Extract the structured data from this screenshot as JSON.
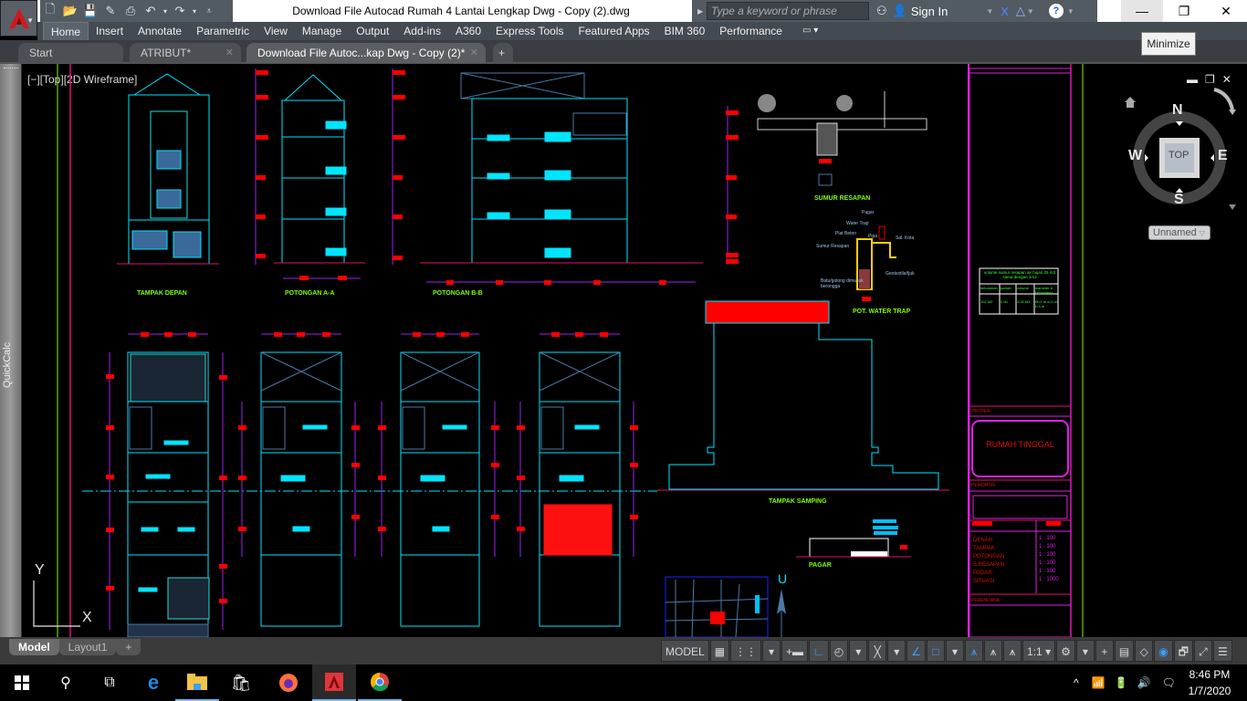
{
  "app": {
    "name": "AutoCAD",
    "document_title": "Download File Autocad Rumah 4 Lantai Lengkap Dwg - Copy (2).dwg"
  },
  "quick_access": [
    "new-icon",
    "open-icon",
    "save-icon",
    "save-as-icon",
    "plot-icon",
    "undo-icon",
    "redo-icon",
    "customize-icon"
  ],
  "infocenter": {
    "search_placeholder": "Type a keyword or phrase",
    "sign_in": "Sign In",
    "help": "?"
  },
  "window_controls": {
    "minimize": "—",
    "restore": "❐",
    "close": "✕",
    "tooltip": "Minimize"
  },
  "ribbon_tabs": [
    {
      "label": "Home",
      "active": true
    },
    {
      "label": "Insert"
    },
    {
      "label": "Annotate"
    },
    {
      "label": "Parametric"
    },
    {
      "label": "View"
    },
    {
      "label": "Manage"
    },
    {
      "label": "Output"
    },
    {
      "label": "Add-ins"
    },
    {
      "label": "A360"
    },
    {
      "label": "Express Tools"
    },
    {
      "label": "Featured Apps"
    },
    {
      "label": "BIM 360"
    },
    {
      "label": "Performance"
    }
  ],
  "doc_tabs": [
    {
      "label": "Start"
    },
    {
      "label": "ATRIBUT*"
    },
    {
      "label": "Download File Autoc...kap Dwg - Copy (2)*",
      "active": true
    }
  ],
  "side_palette": {
    "label": "QuickCalc"
  },
  "viewport": {
    "label": "[−][Top][2D Wireframe]",
    "ucs": {
      "x": "X",
      "y": "Y"
    },
    "viewcube": {
      "n": "N",
      "s": "S",
      "e": "E",
      "w": "W",
      "face": "TOP",
      "named_view": "Unnamed"
    }
  },
  "drawing": {
    "view_titles": [
      "TAMPAK DEPAN",
      "POTONGAN A-A",
      "POTONGAN B-B",
      "SUMUR RESAPAN",
      "POT. WATER TRAP",
      "TAMPAK SAMPING",
      "PAGAR"
    ],
    "north_label": "U",
    "water_trap_labels": [
      "Pagar",
      "Water Trap",
      "Plat Beton",
      "Pipa",
      "Sal. Kota",
      "Sumur Resapan",
      "Geotextile/Ijuk",
      "Batu/golong dimasuk berongga"
    ],
    "title_block": {
      "proyek_label": "PROYEK",
      "project_name": "RUMAH TINGGAL",
      "pemohon_label": "PEMOHON",
      "drawings": [
        {
          "name": "DENAH",
          "scale": "1 : 100"
        },
        {
          "name": "TAMPAK",
          "scale": "1 : 100"
        },
        {
          "name": "POTONGAN",
          "scale": "1 : 100"
        },
        {
          "name": "S.RESAPAN",
          "scale": "1 : 100"
        },
        {
          "name": "PAGAR",
          "scale": "1 : 100"
        },
        {
          "name": "SITUASI",
          "scale": "1 : 1000"
        }
      ],
      "perencana_label": "PERENCANA"
    },
    "resapan_table": {
      "title": "volume sumur resapan air hujan 25 m3 sama dengan 1m3",
      "headers": [
        "kebutuhan",
        "jumlah",
        "volume",
        "diameter & kedalaman"
      ],
      "row": [
        "102 M2",
        "2 bh",
        "4.00 M3",
        "Ø=1 m d=1 m t=3 m"
      ]
    }
  },
  "layout_tabs": [
    {
      "label": "Model",
      "active": true
    },
    {
      "label": "Layout1"
    },
    {
      "label": "+"
    }
  ],
  "status_bar": [
    "MODEL",
    "grid",
    "snap",
    "▾",
    "+▬",
    "ortho",
    "polar",
    "▾",
    "osnap",
    "▾",
    "otrack",
    "dyn",
    "▾",
    "anno-scale",
    "anno-vis",
    "anno-auto",
    "1:1 ▾",
    "gear",
    "▾",
    "+",
    "calc",
    "isolate",
    "hw",
    "clean",
    "fullscreen",
    "menu"
  ],
  "taskbar": {
    "apps": [
      "start",
      "search",
      "task-view",
      "edge",
      "file-explorer",
      "store",
      "firefox",
      "autocad",
      "chrome"
    ],
    "time": "8:46 PM",
    "date": "1/7/2020"
  }
}
